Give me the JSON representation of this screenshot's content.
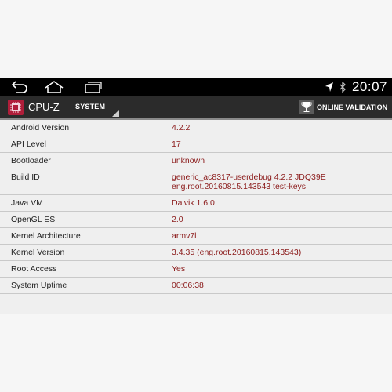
{
  "status_bar": {
    "time": "20:07",
    "icons": [
      "back-icon",
      "home-icon",
      "recent-apps-icon",
      "location-icon",
      "bluetooth-icon"
    ]
  },
  "action_bar": {
    "app_title": "CPU-Z",
    "tab_label": "SYSTEM",
    "online_validation_label": "ONLINE VALIDATION",
    "icons": [
      "cpu-z-logo-icon",
      "dropdown-icon",
      "trophy-icon"
    ]
  },
  "system_info": [
    {
      "label": "Android Version",
      "value": "4.2.2"
    },
    {
      "label": "API Level",
      "value": "17"
    },
    {
      "label": "Bootloader",
      "value": "unknown"
    },
    {
      "label": "Build ID",
      "value": "generic_ac8317-userdebug 4.2.2 JDQ39E",
      "value2": "eng.root.20160815.143543 test-keys"
    },
    {
      "label": "Java VM",
      "value": "Dalvik 1.6.0"
    },
    {
      "label": "OpenGL ES",
      "value": "2.0"
    },
    {
      "label": "Kernel Architecture",
      "value": "armv7l"
    },
    {
      "label": "Kernel Version",
      "value": "3.4.35 (eng.root.20160815.143543)"
    },
    {
      "label": "Root Access",
      "value": "Yes"
    },
    {
      "label": "System Uptime",
      "value": "00:06:38"
    }
  ],
  "colors": {
    "value_text": "#8b1a1a",
    "action_bar": "#2b2b2b",
    "nav_bar": "#000000",
    "logo": "#b01e3a"
  }
}
